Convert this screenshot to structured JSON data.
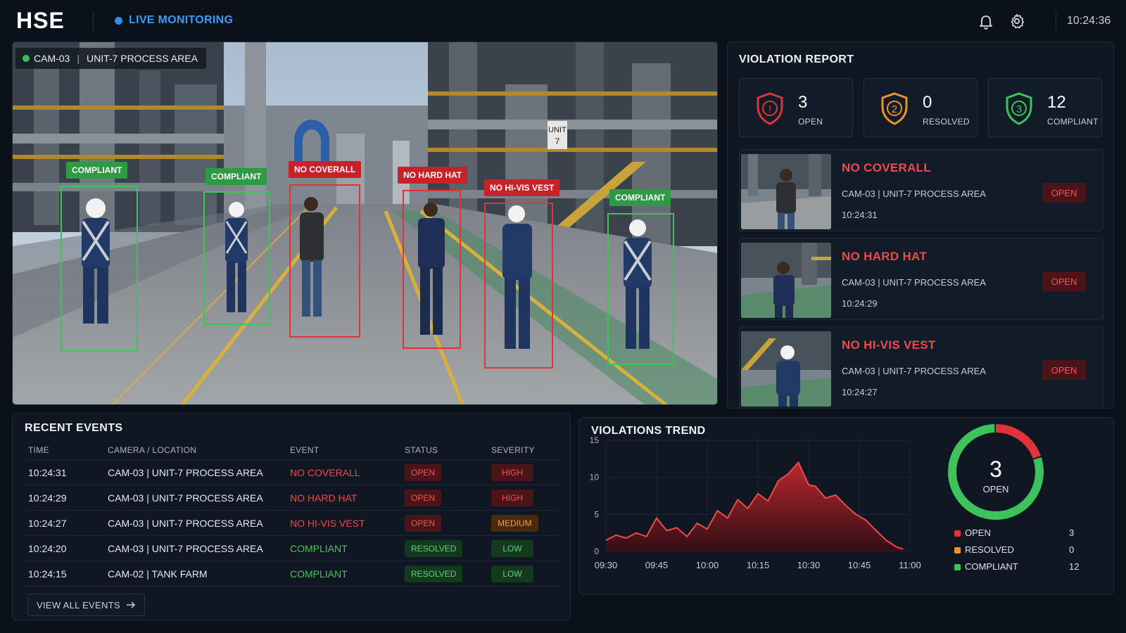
{
  "header": {
    "logo": "HSE",
    "live_label": "LIVE MONITORING",
    "clock": "10:24:36",
    "icons": [
      "bell-icon",
      "gear-icon"
    ]
  },
  "camera": {
    "label_cam": "CAM-03",
    "label_sep": "|",
    "label_area": "UNIT-7 PROCESS AREA",
    "sign_text_1": "UNIT",
    "sign_text_2": "7",
    "detections": [
      {
        "label": "COMPLIANT",
        "status": "ok"
      },
      {
        "label": "COMPLIANT",
        "status": "ok"
      },
      {
        "label": "NO COVERALL",
        "status": "bad"
      },
      {
        "label": "NO HARD HAT",
        "status": "bad"
      },
      {
        "label": "NO HI-VIS VEST",
        "status": "bad"
      },
      {
        "label": "COMPLIANT",
        "status": "ok"
      }
    ]
  },
  "violation_report": {
    "title": "VIOLATION REPORT",
    "stats": [
      {
        "value": "3",
        "label": "OPEN",
        "color": "#e0343a",
        "icon_glyph": "!"
      },
      {
        "value": "0",
        "label": "RESOLVED",
        "color": "#f0922a",
        "icon_glyph": "2"
      },
      {
        "value": "12",
        "label": "COMPLIANT",
        "color": "#3ec25b",
        "icon_glyph": "3"
      }
    ],
    "items": [
      {
        "title": "NO COVERALL",
        "location": "CAM-03  |  UNIT-7 PROCESS AREA",
        "time": "10:24:31",
        "status": "OPEN"
      },
      {
        "title": "NO HARD HAT",
        "location": "CAM-03  |  UNIT-7 PROCESS AREA",
        "time": "10:24:29",
        "status": "OPEN"
      },
      {
        "title": "NO HI-VIS VEST",
        "location": "CAM-03  |  UNIT-7 PROCESS AREA",
        "time": "10:24:27",
        "status": "OPEN"
      }
    ]
  },
  "recent_events": {
    "title": "RECENT EVENTS",
    "columns": [
      "TIME",
      "CAMERA / LOCATION",
      "EVENT",
      "STATUS",
      "SEVERITY"
    ],
    "rows": [
      {
        "time": "10:24:31",
        "location": "CAM-03  |  UNIT-7 PROCESS AREA",
        "event": "NO COVERALL",
        "status": "OPEN",
        "severity": "HIGH"
      },
      {
        "time": "10:24:29",
        "location": "CAM-03  |  UNIT-7 PROCESS AREA",
        "event": "NO HARD HAT",
        "status": "OPEN",
        "severity": "HIGH"
      },
      {
        "time": "10:24:27",
        "location": "CAM-03  |  UNIT-7 PROCESS AREA",
        "event": "NO HI-VIS VEST",
        "status": "OPEN",
        "severity": "MEDIUM"
      },
      {
        "time": "10:24:20",
        "location": "CAM-03  |  UNIT-7 PROCESS AREA",
        "event": "COMPLIANT",
        "status": "RESOLVED",
        "severity": "LOW"
      },
      {
        "time": "10:24:15",
        "location": "CAM-02  |  TANK FARM",
        "event": "COMPLIANT",
        "status": "RESOLVED",
        "severity": "LOW"
      }
    ],
    "view_all_label": "VIEW ALL EVENTS"
  },
  "trend": {
    "title": "VIOLATIONS TREND",
    "donut_value": "3",
    "donut_label": "OPEN",
    "legend": [
      {
        "label": "OPEN",
        "value": "3",
        "color": "#e0343a"
      },
      {
        "label": "RESOLVED",
        "value": "0",
        "color": "#f0922a"
      },
      {
        "label": "COMPLIANT",
        "value": "12",
        "color": "#3ec25b"
      }
    ]
  },
  "chart_data": {
    "type": "area",
    "title": "VIOLATIONS TREND",
    "xlabel": "",
    "ylabel": "",
    "x_ticks": [
      "09:30",
      "09:45",
      "10:00",
      "10:15",
      "10:30",
      "10:45",
      "11:00"
    ],
    "y_ticks": [
      0,
      5,
      10,
      15
    ],
    "ylim": [
      0,
      15
    ],
    "xlim_minutes": [
      0,
      90
    ],
    "grid": true,
    "series": [
      {
        "color": "#e0343a",
        "x_minutes": [
          0,
          3,
          6,
          9,
          12,
          15,
          18,
          21,
          24,
          27,
          30,
          33,
          36,
          39,
          42,
          45,
          48,
          51,
          54,
          57,
          60,
          62,
          65,
          68,
          71,
          74,
          77,
          80,
          83,
          86,
          88
        ],
        "values": [
          1.5,
          2.2,
          1.8,
          2.5,
          2.0,
          4.5,
          2.8,
          3.2,
          2.0,
          3.8,
          3.0,
          5.5,
          4.5,
          7.0,
          5.8,
          7.8,
          6.8,
          9.5,
          10.5,
          12.0,
          9.0,
          8.8,
          7.2,
          7.6,
          6.2,
          5.0,
          4.2,
          2.8,
          1.5,
          0.6,
          0.3
        ]
      }
    ],
    "donut": {
      "values": [
        3,
        0,
        12
      ],
      "labels": [
        "OPEN",
        "RESOLVED",
        "COMPLIANT"
      ],
      "colors": [
        "#e0343a",
        "#f0922a",
        "#3ec25b"
      ]
    }
  }
}
